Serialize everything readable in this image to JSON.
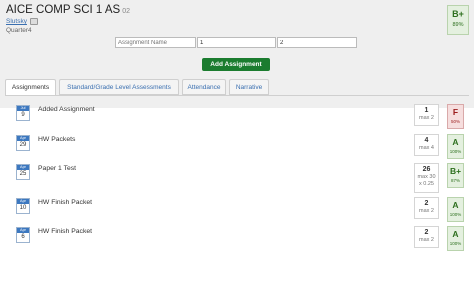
{
  "course": {
    "title": "AICE COMP SCI 1 AS",
    "section": "02",
    "teacher": "Slutsky",
    "term": "Quarter4"
  },
  "overall": {
    "grade": "B+",
    "percent": "89%"
  },
  "new_assignment": {
    "name_placeholder": "Assignment Name",
    "field1_value": "1",
    "field2_value": "2",
    "add_label": "Add Assignment"
  },
  "tabs": [
    "Assignments",
    "Standard/Grade Level Assessments",
    "Attendance",
    "Narrative"
  ],
  "assignments": [
    {
      "month": "Jul",
      "day": "9",
      "name": "Added Assignment",
      "score": "1",
      "max": "max 2",
      "extra": "",
      "grade": "F",
      "percent": "50%"
    },
    {
      "month": "Apr",
      "day": "29",
      "name": "HW Packets",
      "score": "4",
      "max": "max 4",
      "extra": "",
      "grade": "A",
      "percent": "100%"
    },
    {
      "month": "Apr",
      "day": "25",
      "name": "Paper 1 Test",
      "score": "26",
      "max": "max 30",
      "extra": "x 0.25",
      "grade": "B+",
      "percent": "87%"
    },
    {
      "month": "Apr",
      "day": "10",
      "name": "HW Finish Packet",
      "score": "2",
      "max": "max 2",
      "extra": "",
      "grade": "A",
      "percent": "100%"
    },
    {
      "month": "Apr",
      "day": "6",
      "name": "HW Finish Packet",
      "score": "2",
      "max": "max 2",
      "extra": "",
      "grade": "A",
      "percent": "100%"
    }
  ]
}
